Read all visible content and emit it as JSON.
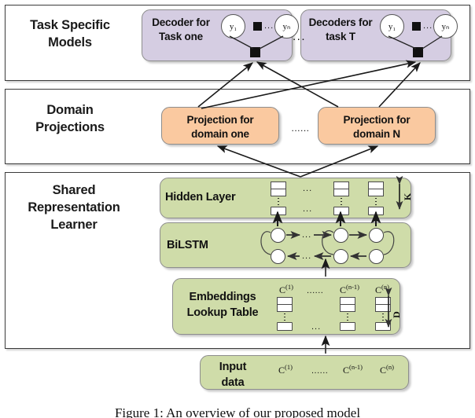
{
  "figure": {
    "caption": "Figure 1: An overview of our proposed model"
  },
  "sections": [
    {
      "id": "task",
      "title": "Task Specific\nModels"
    },
    {
      "id": "domain",
      "title": "Domain\nProjections"
    },
    {
      "id": "shared",
      "title": "Shared\nRepresentation\nLearner"
    }
  ],
  "task_models": {
    "decoders": [
      {
        "label": "Decoder for\nTask one",
        "nodes": [
          "y₁",
          "yₙ"
        ]
      },
      {
        "label": "Decoders for\ntask T",
        "nodes": [
          "y₁",
          "yₙ"
        ]
      }
    ],
    "between_ellipsis": "...",
    "node_ellipsis": "..."
  },
  "domain_projections": {
    "boxes": [
      {
        "label": "Projection for\ndomain one"
      },
      {
        "label": "Projection for\ndomain N"
      }
    ],
    "between_ellipsis": "......"
  },
  "shared_representation": {
    "hidden_layer": {
      "label": "Hidden Layer",
      "dim_label": "K",
      "column_ellipsis": "...",
      "units": 3
    },
    "bilstm": {
      "label": "BiLSTM",
      "forward_ellipsis": "...",
      "backward_ellipsis": "..."
    },
    "embeddings": {
      "label": "Embeddings\nLookup Table",
      "dim_label": "D",
      "column_labels": [
        "C(1)",
        "C(n-1)",
        "C(n)"
      ],
      "column_sup": [
        "(1)",
        "(n-1)",
        "(n)"
      ],
      "column_base": "C",
      "between_ellipsis": "......",
      "bottom_ellipsis": "..."
    },
    "input_data": {
      "label": "Input\ndata",
      "column_labels": [
        "C(1)",
        "C(n-1)",
        "C(n)"
      ],
      "between_ellipsis": "......"
    }
  },
  "colors": {
    "task_block": "#d5cde2",
    "domain_block": "#fac9a0",
    "shared_block": "#cfdca9",
    "frame_border": "#3a3a3a",
    "arrow": "#2b2b2b"
  }
}
